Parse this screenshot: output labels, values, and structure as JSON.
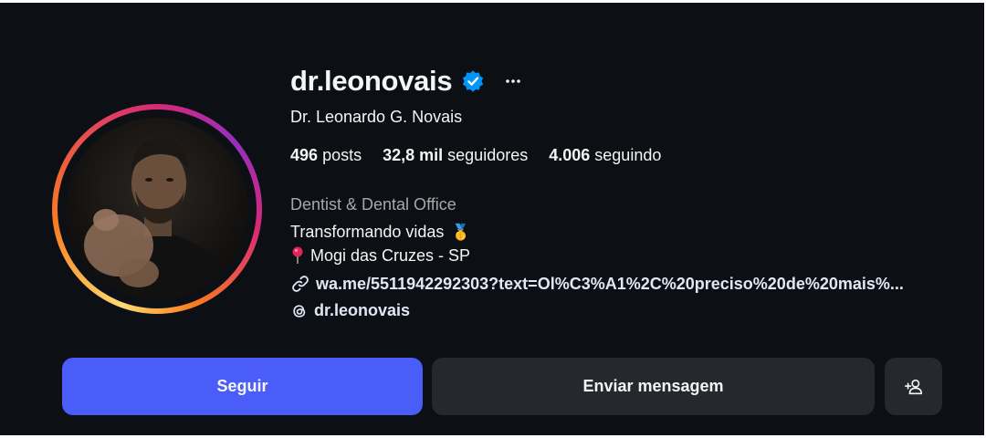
{
  "profile": {
    "username": "dr.leonovais",
    "full_name": "Dr. Leonardo G. Novais",
    "verified": true
  },
  "stats": {
    "posts_count": "496",
    "posts_label": "posts",
    "followers_count": "32,8 mil",
    "followers_label": "seguidores",
    "following_count": "4.006",
    "following_label": "seguindo"
  },
  "bio": {
    "category": "Dentist & Dental Office",
    "line1": "Transformando vidas",
    "line1_emoji": "🥇",
    "line2": "Mogi das Cruzes - SP",
    "link": "wa.me/5511942292303?text=Ol%C3%A1%2C%20preciso%20de%20mais%...",
    "threads_handle": "dr.leonovais"
  },
  "actions": {
    "follow_label": "Seguir",
    "message_label": "Enviar mensagem"
  },
  "icons": {
    "verified": "verified-badge-icon",
    "more": "more-options-icon",
    "pin": "location-pin-icon",
    "link": "link-icon",
    "threads": "threads-icon",
    "suggest": "add-person-icon"
  },
  "colors": {
    "background": "#0c0f14",
    "follow_button": "#4a5df9",
    "secondary_button": "#25292e",
    "verified_badge": "#0095f6",
    "muted_text": "#a8a8a8"
  }
}
